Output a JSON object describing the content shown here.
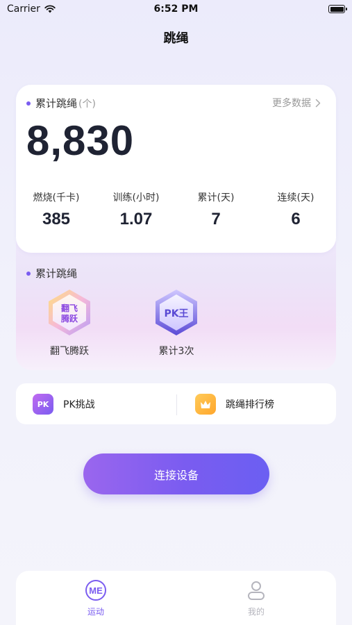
{
  "status_bar": {
    "carrier": "Carrier",
    "time": "6:52 PM"
  },
  "nav": {
    "title": "跳绳"
  },
  "stats": {
    "title": "累计跳绳",
    "unit": "(个)",
    "more_link": "更多数据",
    "total": "8,830",
    "metrics": [
      {
        "label": "燃烧(千卡)",
        "value": "385"
      },
      {
        "label": "训练(小时)",
        "value": "1.07"
      },
      {
        "label": "累计(天)",
        "value": "7"
      },
      {
        "label": "连续(天)",
        "value": "6"
      }
    ]
  },
  "badges": {
    "title": "累计跳绳",
    "items": [
      {
        "label": "翻飞腾跃",
        "icon": "fanfei-badge-icon",
        "icon_text": [
          "翻飞",
          "腾跃"
        ]
      },
      {
        "label": "累计3次",
        "icon": "pk-king-badge-icon",
        "icon_text": [
          "PK王"
        ]
      }
    ]
  },
  "actions": {
    "pk": {
      "label": "PK挑战",
      "icon": "pk-icon",
      "icon_text": "PK"
    },
    "ranking": {
      "label": "跳绳排行榜",
      "icon": "crown-icon"
    }
  },
  "connect_button": {
    "label": "连接设备"
  },
  "tabbar": {
    "tabs": [
      {
        "label": "运动",
        "icon": "me-logo-icon",
        "active": true
      },
      {
        "label": "我的",
        "icon": "person-icon",
        "active": false
      }
    ]
  },
  "colors": {
    "accent": "#7a5cf0",
    "tab_active": "#7a5cf0",
    "tab_inactive": "#b5b5bd",
    "crown": "#ffb43a"
  }
}
